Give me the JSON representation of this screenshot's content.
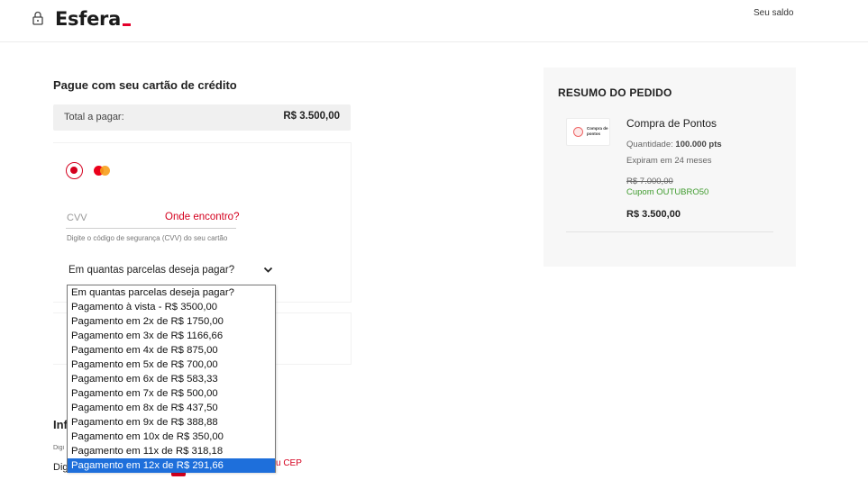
{
  "header": {
    "logo": "Esfera",
    "saldo_label": "Seu saldo"
  },
  "payment": {
    "title": "Pague com seu cartão de crédito",
    "total_label": "Total a pagar:",
    "total_value": "R$ 3.500,00",
    "cvv_placeholder": "CVV",
    "cvv_help_link": "Onde encontro?",
    "cvv_hint": "Digite o código de segurança (CVV) do seu cartão",
    "installments_selected": "Em quantas parcelas deseja pagar?",
    "installment_options": [
      "Em quantas parcelas deseja pagar?",
      "Pagamento à vista - R$ 3500,00",
      "Pagamento em 2x de R$ 1750,00",
      "Pagamento em 3x de R$ 1166,66",
      "Pagamento em 4x de R$ 875,00",
      "Pagamento em 5x de R$ 700,00",
      "Pagamento em 6x de R$ 583,33",
      "Pagamento em 7x de R$ 500,00",
      "Pagamento em 8x de R$ 437,50",
      "Pagamento em 9x de R$ 388,88",
      "Pagamento em 10x de R$ 350,00",
      "Pagamento em 11x de R$ 318,18",
      "Pagamento em 12x de R$ 291,66"
    ],
    "highlighted_option_index": 12
  },
  "info": {
    "title": "Inf",
    "field_label": "Digi",
    "field_value": "Dig",
    "cep_link": "u CEP"
  },
  "summary": {
    "title": "RESUMO DO PEDIDO",
    "thumb_text": "Compra de pontos",
    "product_name": "Compra de Pontos",
    "quantity_label": "Quantidade:",
    "quantity_value": "100.000 pts",
    "expire": "Expiram em 24 meses",
    "old_price": "R$ 7.000,00",
    "coupon": "Cupom OUTUBRO50",
    "new_price": "R$ 3.500,00"
  },
  "colors": {
    "brand_red": "#d4001e",
    "coupon_green": "#3f9b2e",
    "selection_blue": "#1e6fdb"
  },
  "icons": [
    "lock-icon",
    "mastercard-icon",
    "chevron-down-icon",
    "coin-icon"
  ]
}
